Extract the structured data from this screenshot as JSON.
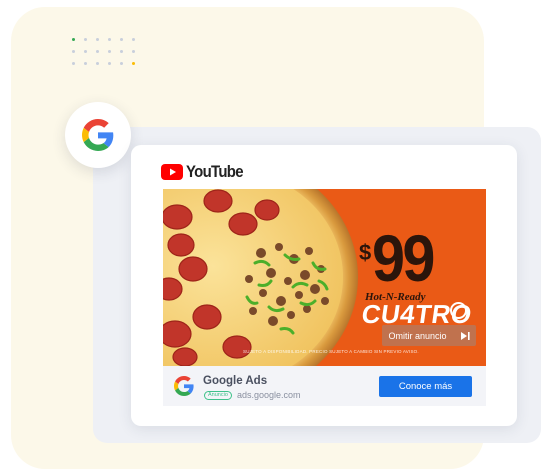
{
  "colors": {
    "cream_background": "#fcf8e9",
    "panel_gray": "#eef0f5",
    "banner_orange": "#ea5a16",
    "cta_blue": "#1a73e8",
    "youtube_red": "#ff0000",
    "badge_green": "#3fc28a"
  },
  "youtube": {
    "brand": "YouTube",
    "icon": "youtube-play-icon"
  },
  "ad": {
    "currency": "$",
    "price": "99",
    "tagline": "Hot-N-Ready",
    "product": "CU4TRO",
    "skip_label": "Omitir anuncio",
    "skip_icon": "skip-next-icon",
    "disclaimer": "SUJETO A DISPONIBILIDAD. PRECIO SUJETO A CAMBIO SIN PREVIO AVISO."
  },
  "footer": {
    "advertiser": "Google Ads",
    "badge": "Anuncio",
    "url": "ads.google.com",
    "cta_label": "Conoce más",
    "logo_icon": "google-g-icon"
  },
  "decor": {
    "big_logo_icon": "google-g-icon"
  }
}
